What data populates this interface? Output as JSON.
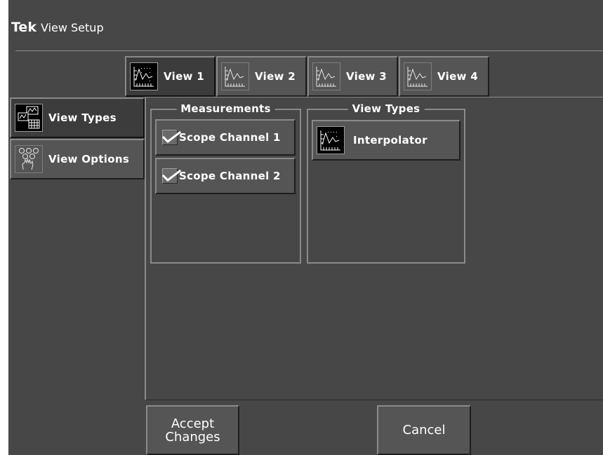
{
  "app": {
    "brand": "Tek",
    "title": "View Setup"
  },
  "view_tabs": [
    {
      "label": "View 1",
      "icon": "waveform-chart-icon",
      "selected": true
    },
    {
      "label": "View 2",
      "icon": "waveform-chart-icon",
      "selected": false
    },
    {
      "label": "View 3",
      "icon": "waveform-chart-icon",
      "selected": false
    },
    {
      "label": "View 4",
      "icon": "waveform-chart-icon",
      "selected": false
    }
  ],
  "sidebar": {
    "items": [
      {
        "label": "View Types",
        "icon": "view-types-icon",
        "selected": true
      },
      {
        "label": "View Options",
        "icon": "view-options-icon",
        "selected": false
      }
    ]
  },
  "measurements": {
    "legend": "Measurements",
    "items": [
      {
        "label": "Scope Channel 1",
        "checked": true
      },
      {
        "label": "Scope Channel 2",
        "checked": true
      }
    ]
  },
  "view_types": {
    "legend": "View Types",
    "items": [
      {
        "label": "Interpolator",
        "icon": "waveform-chart-icon"
      }
    ]
  },
  "actions": {
    "accept": "Accept\nChanges",
    "cancel": "Cancel"
  },
  "colors": {
    "background": "#474747",
    "button": "#555555",
    "text": "#ffffff"
  }
}
